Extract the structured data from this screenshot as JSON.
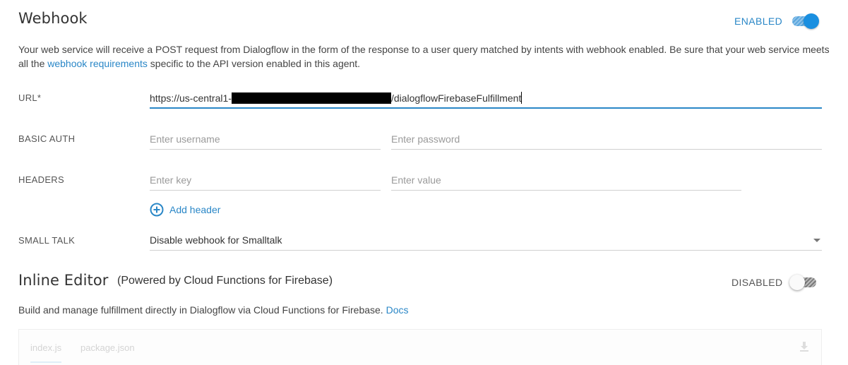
{
  "webhook": {
    "title": "Webhook",
    "status_label": "ENABLED",
    "enabled": true,
    "description_part1": "Your web service will receive a POST request from Dialogflow in the form of the response to a user query matched by intents with webhook enabled. Be sure that your web service meets all the ",
    "description_link": "webhook requirements",
    "description_part2": " specific to the API version enabled in this agent.",
    "url": {
      "label": "URL*",
      "value_prefix": "https://us-central1-",
      "value_suffix": "/dialogflowFirebaseFulfillment"
    },
    "basic_auth": {
      "label": "BASIC AUTH",
      "username_placeholder": "Enter username",
      "password_placeholder": "Enter password"
    },
    "headers": {
      "label": "HEADERS",
      "key_placeholder": "Enter key",
      "value_placeholder": "Enter value",
      "add_header_label": "Add header"
    },
    "small_talk": {
      "label": "SMALL TALK",
      "selected": "Disable webhook for Smalltalk"
    }
  },
  "inline_editor": {
    "title": "Inline Editor",
    "subtitle": "(Powered by Cloud Functions for Firebase)",
    "status_label": "DISABLED",
    "enabled": false,
    "description": "Build and manage fulfillment directly in Dialogflow via Cloud Functions for Firebase. ",
    "docs_link": "Docs",
    "tabs": [
      "index.js",
      "package.json"
    ]
  },
  "colors": {
    "accent": "#2a87c7",
    "toggle_on": "#1a8fe0",
    "text": "#333333"
  }
}
